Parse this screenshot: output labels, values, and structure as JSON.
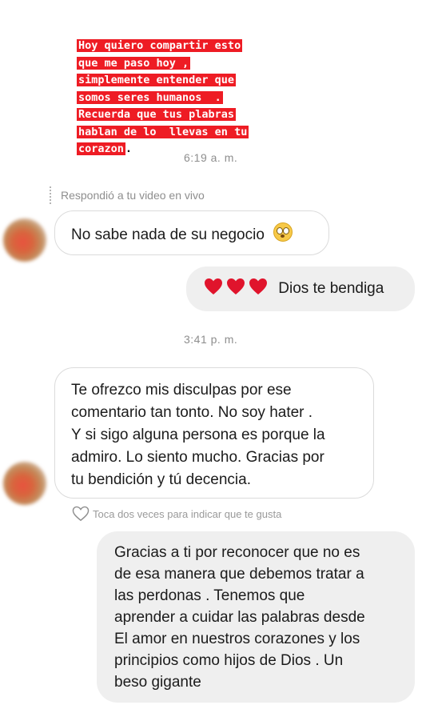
{
  "story": {
    "lines": [
      "Hoy quiero compartir esto",
      "que me paso hoy ,",
      "simplemente entender que",
      "somos seres humanos  .",
      "Recuerda que tus plabras",
      "hablan de lo  llevas en tu",
      "corazon"
    ],
    "trailing": "."
  },
  "timestamps": {
    "first": "6:19 a. m.",
    "second": "3:41 p. m."
  },
  "reply_note": "Respondió a tu video en vivo",
  "messages": {
    "m1": "No sabe nada de su negocio",
    "m1_emoji": "flushed-face",
    "m2": "Dios te bendiga",
    "m2_emoji_count": 3,
    "m3_lines": [
      "Te ofrezco mis disculpas por ese",
      "comentario tan tonto. No soy hater .",
      "Y si sigo alguna persona es porque la",
      "admiro. Lo siento mucho. Gracias por",
      "tu bendición y tú decencia."
    ],
    "m4_lines": [
      "Gracias a ti por reconocer que no es",
      "de esa manera que debemos tratar a",
      "las perdonas . Tenemos que",
      "aprender a cuidar las palabras desde",
      "El amor en nuestros corazones y los",
      "principios como hijos de Dios . Un",
      "beso gigante"
    ]
  },
  "like_hint": "Toca dos veces para indicar que te gusta",
  "colors": {
    "highlight": "#ee1c24",
    "bubble_out": "#efefef",
    "meta_text": "#8e8e8e",
    "heart": "#e0142c"
  }
}
